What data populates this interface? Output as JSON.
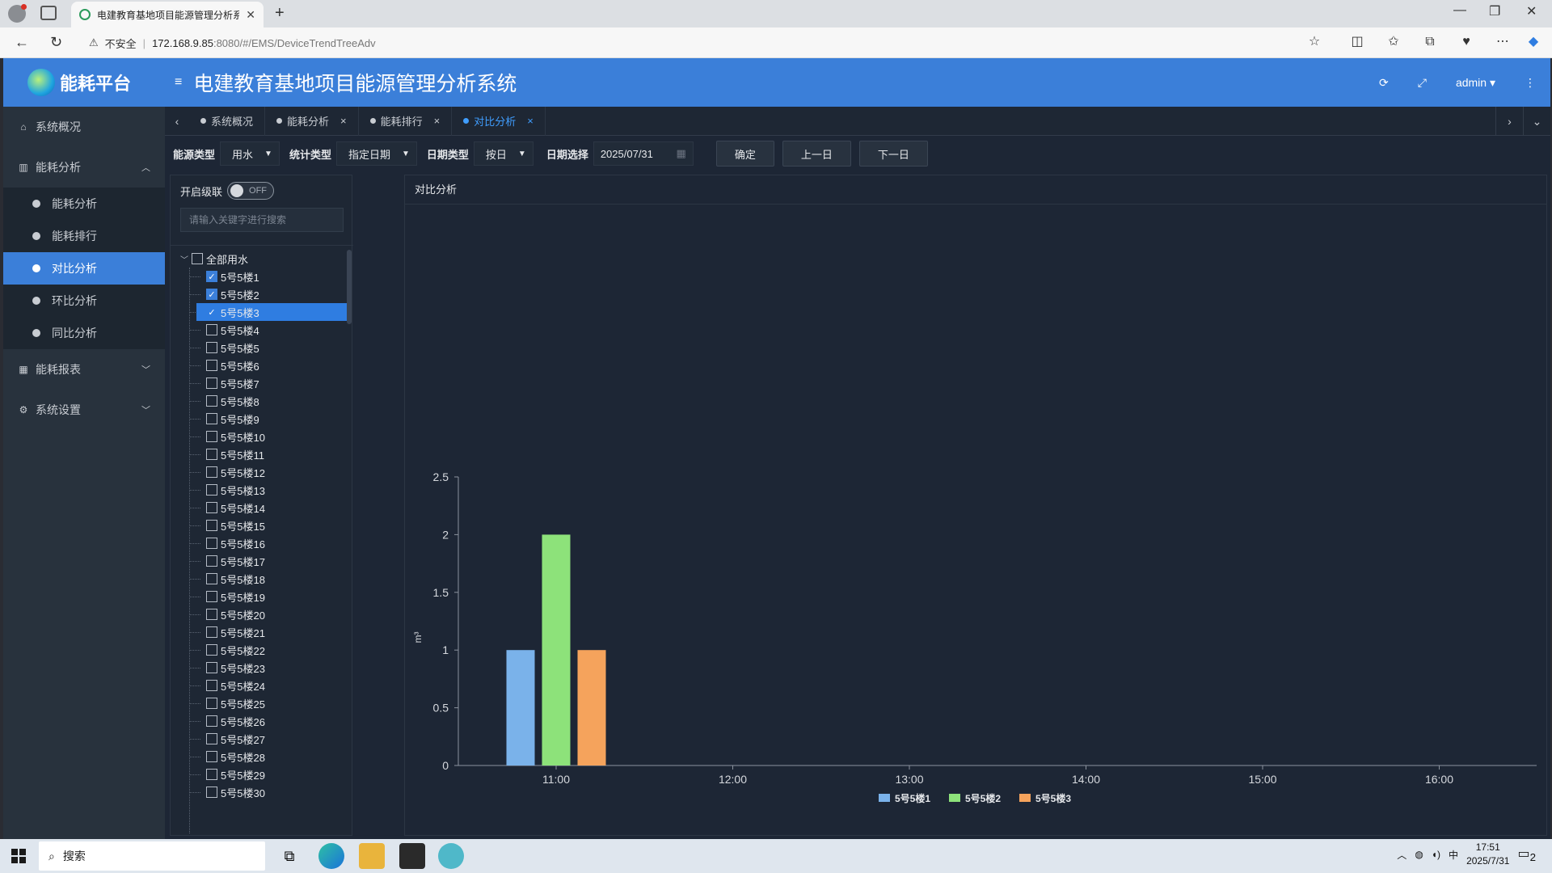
{
  "browser": {
    "tab_title": "电建教育基地项目能源管理分析系统",
    "new_tab": "+",
    "security_label": "不安全",
    "url_host": "172.168.9.85",
    "url_rest": ":8080/#/EMS/DeviceTrendTreeAdv",
    "controls": {
      "minimize": "—",
      "restore": "❐",
      "close": "✕"
    }
  },
  "app": {
    "logo_text": "能耗平台",
    "header_title": "电建教育基地项目能源管理分析系统",
    "user": "admin"
  },
  "sidebar": {
    "overview": "系统概况",
    "analysis_group": "能耗分析",
    "sub_items": [
      "能耗分析",
      "能耗排行",
      "对比分析",
      "环比分析",
      "同比分析"
    ],
    "active_index": 2,
    "report_group": "能耗报表",
    "settings_group": "系统设置"
  },
  "page_tabs": [
    {
      "label": "系统概况",
      "closable": false
    },
    {
      "label": "能耗分析",
      "closable": true
    },
    {
      "label": "能耗排行",
      "closable": true
    },
    {
      "label": "对比分析",
      "closable": true,
      "active": true
    }
  ],
  "filters": {
    "energy_type_label": "能源类型",
    "energy_type_value": "用水",
    "stat_type_label": "统计类型",
    "stat_type_value": "指定日期",
    "date_type_label": "日期类型",
    "date_type_value": "按日",
    "date_select_label": "日期选择",
    "date_value": "2025/07/31",
    "confirm": "确定",
    "prev_day": "上一日",
    "next_day": "下一日"
  },
  "tree": {
    "cascade_label": "开启级联",
    "cascade_state": "OFF",
    "search_placeholder": "请输入关键字进行搜索",
    "root_label": "全部用水",
    "children": [
      "5号5楼1",
      "5号5楼2",
      "5号5楼3",
      "5号5楼4",
      "5号5楼5",
      "5号5楼6",
      "5号5楼7",
      "5号5楼8",
      "5号5楼9",
      "5号5楼10",
      "5号5楼11",
      "5号5楼12",
      "5号5楼13",
      "5号5楼14",
      "5号5楼15",
      "5号5楼16",
      "5号5楼17",
      "5号5楼18",
      "5号5楼19",
      "5号5楼20",
      "5号5楼21",
      "5号5楼22",
      "5号5楼23",
      "5号5楼24",
      "5号5楼25",
      "5号5楼26",
      "5号5楼27",
      "5号5楼28",
      "5号5楼29",
      "5号5楼30"
    ],
    "checked": [
      0,
      1,
      2
    ],
    "selected": 2
  },
  "chart_panel_title": "对比分析",
  "chart_data": {
    "type": "bar",
    "title": "",
    "xlabel": "",
    "ylabel": "m³",
    "x_ticks": [
      "11:00",
      "12:00",
      "13:00",
      "14:00",
      "15:00",
      "16:00"
    ],
    "categories": [
      "11:00"
    ],
    "ylim": [
      0,
      2.5
    ],
    "y_ticks": [
      0,
      0.5,
      1,
      1.5,
      2,
      2.5
    ],
    "series": [
      {
        "name": "5号5楼1",
        "values": [
          1
        ],
        "color": "#7ab2ea"
      },
      {
        "name": "5号5楼2",
        "values": [
          2
        ],
        "color": "#8de27a"
      },
      {
        "name": "5号5楼3",
        "values": [
          1
        ],
        "color": "#f5a35c"
      }
    ],
    "legend": "bottom-center",
    "grid": false
  },
  "taskbar": {
    "search": "搜索",
    "ime": "中",
    "time": "17:51",
    "date": "2025/7/31",
    "notifications": "2"
  }
}
